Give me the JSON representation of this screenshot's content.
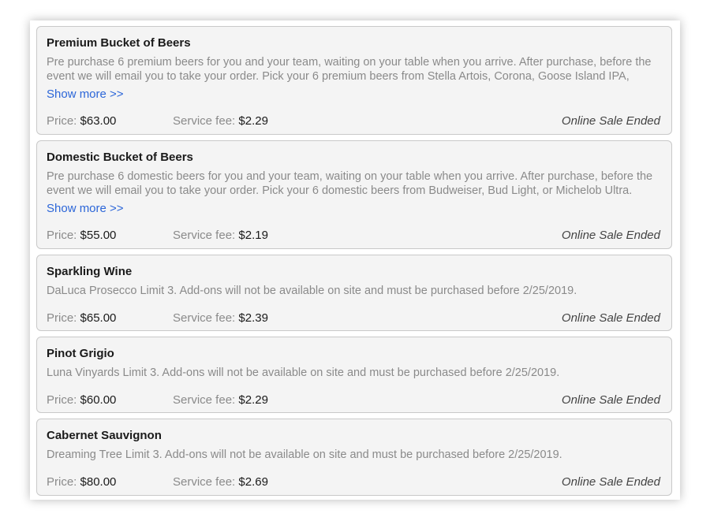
{
  "labels": {
    "price": "Price:",
    "service_fee": "Service fee:",
    "show_more": "Show more >>"
  },
  "colors": {
    "link": "#2c66d8",
    "muted_text": "#8a8a8a",
    "card_background": "#f4f4f4"
  },
  "items": [
    {
      "title": "Premium Bucket of Beers",
      "description": "Pre purchase 6 premium beers for you and your team, waiting on your table when you arrive. After purchase, before the event we will email you to take your order. Pick your 6 premium beers from Stella Artois, Corona, Goose Island IPA,",
      "show_more": true,
      "price": "$63.00",
      "service_fee": "$2.29",
      "status": "Online Sale Ended"
    },
    {
      "title": "Domestic Bucket of Beers",
      "description": "Pre purchase 6 domestic beers for you and your team, waiting on your table when you arrive. After purchase, before the event we will email you to take your order. Pick your 6 domestic beers from Budweiser, Bud Light, or Michelob Ultra.",
      "show_more": true,
      "price": "$55.00",
      "service_fee": "$2.19",
      "status": "Online Sale Ended"
    },
    {
      "title": "Sparkling Wine",
      "description": "DaLuca Prosecco Limit 3. Add-ons will not be available on site and must be purchased before 2/25/2019.",
      "show_more": false,
      "price": "$65.00",
      "service_fee": "$2.39",
      "status": "Online Sale Ended"
    },
    {
      "title": "Pinot Grigio",
      "description": "Luna Vinyards Limit 3. Add-ons will not be available on site and must be purchased before 2/25/2019.",
      "show_more": false,
      "price": "$60.00",
      "service_fee": "$2.29",
      "status": "Online Sale Ended"
    },
    {
      "title": "Cabernet Sauvignon",
      "description": "Dreaming Tree Limit 3. Add-ons will not be available on site and must be purchased before 2/25/2019.",
      "show_more": false,
      "price": "$80.00",
      "service_fee": "$2.69",
      "status": "Online Sale Ended"
    }
  ]
}
